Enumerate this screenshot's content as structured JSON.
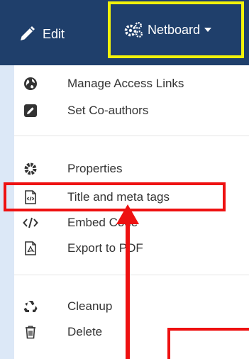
{
  "navbar": {
    "edit_label": "Edit",
    "netboard_label": "Netboard",
    "colors": {
      "background": "#1f3f6b",
      "text": "#ffffff",
      "netboard_outline": "#f2f20a"
    }
  },
  "menu": {
    "groups": [
      [
        {
          "label": "Manage Access Links",
          "icon": "globe-icon"
        },
        {
          "label": "Set Co-authors",
          "icon": "edit-square-icon"
        }
      ],
      [
        {
          "label": "Properties",
          "icon": "gear-icon"
        },
        {
          "label": "Title and meta tags",
          "icon": "code-file-icon"
        },
        {
          "label": "Embed Code",
          "icon": "code-icon"
        },
        {
          "label": "Export to PDF",
          "icon": "pdf-file-icon"
        }
      ],
      [
        {
          "label": "Cleanup",
          "icon": "recycle-icon"
        },
        {
          "label": "Delete",
          "icon": "trash-icon"
        }
      ]
    ]
  },
  "annotation": {
    "highlight_color": "#ee1111",
    "highlighted_item": "Title and meta tags"
  }
}
